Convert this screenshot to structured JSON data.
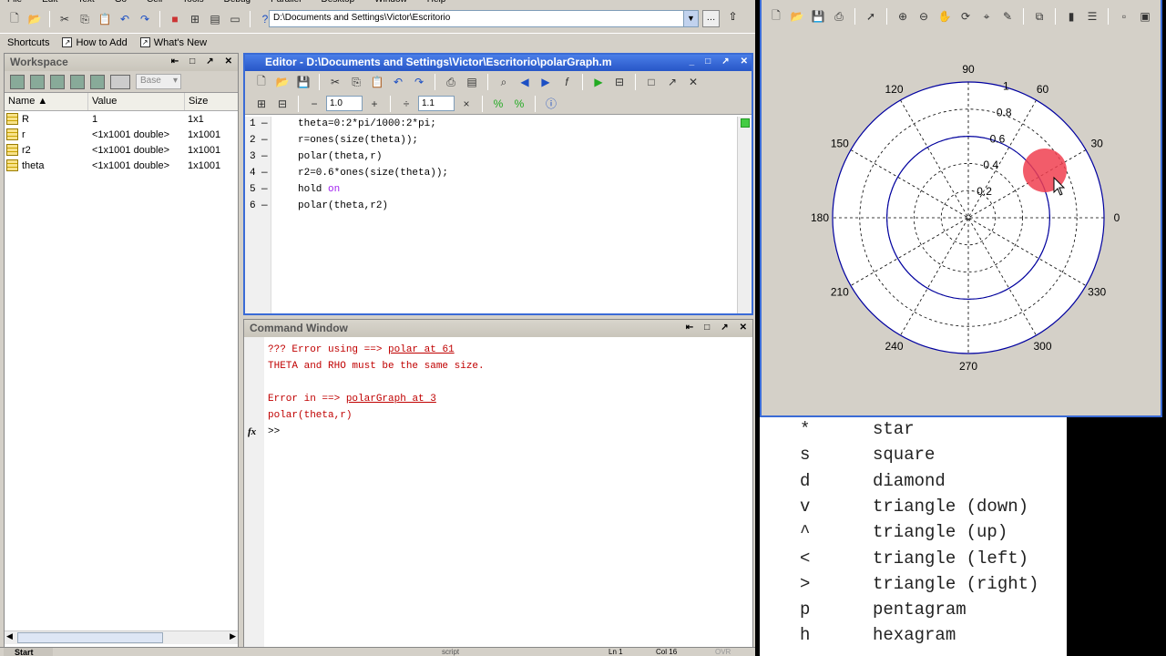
{
  "menu": [
    "File",
    "Edit",
    "Text",
    "Go",
    "Cell",
    "Tools",
    "Debug",
    "Parallel",
    "Desktop",
    "Window",
    "Help"
  ],
  "current_folder": "D:\\Documents and Settings\\Victor\\Escritorio",
  "shortcuts": {
    "label": "Shortcuts",
    "how_to_add": "How to Add",
    "whats_new": "What's New"
  },
  "workspace": {
    "title": "Workspace",
    "base_label": "Base",
    "columns": [
      "Name",
      "Value",
      "Size"
    ],
    "rows": [
      {
        "name": "R",
        "value": "1",
        "size": "1x1"
      },
      {
        "name": "r",
        "value": "<1x1001 double>",
        "size": "1x1001"
      },
      {
        "name": "r2",
        "value": "<1x1001 double>",
        "size": "1x1001"
      },
      {
        "name": "theta",
        "value": "<1x1001 double>",
        "size": "1x1001"
      }
    ]
  },
  "editor": {
    "title": "Editor - D:\\Documents and Settings\\Victor\\Escritorio\\polarGraph.m",
    "step1": "1.0",
    "step2": "1.1",
    "lines": [
      {
        "n": "1",
        "code": "theta=0:2*pi/1000:2*pi;"
      },
      {
        "n": "2",
        "code": "r=ones(size(theta));"
      },
      {
        "n": "3",
        "code": "polar(theta,r)"
      },
      {
        "n": "4",
        "code": "r2=0.6*ones(size(theta));"
      },
      {
        "n": "5",
        "code": "hold ",
        "kw": "on"
      },
      {
        "n": "6",
        "code": "polar(theta,r2)"
      }
    ]
  },
  "command_window": {
    "title": "Command Window",
    "err1_pre": "??? Error using ==> ",
    "err1_link": "polar at 61",
    "err2": "THETA and RHO must be the same size.",
    "err3_pre": "Error in ==> ",
    "err3_link": "polarGraph at 3",
    "err4": "polar(theta,r)",
    "prompt": ">>",
    "fx": "fx"
  },
  "figure": {
    "angle_labels": [
      "0",
      "30",
      "60",
      "90",
      "120",
      "150",
      "180",
      "210",
      "240",
      "270",
      "300",
      "330"
    ],
    "radius_labels": [
      "0.2",
      "0.4",
      "0.6",
      "0.8",
      "1"
    ],
    "colors": {
      "curve": "#0000a0",
      "highlight": "#f04050"
    }
  },
  "markers": [
    {
      "sym": "*",
      "desc": "star"
    },
    {
      "sym": "s",
      "desc": "square"
    },
    {
      "sym": "d",
      "desc": "diamond"
    },
    {
      "sym": "v",
      "desc": "triangle (down)"
    },
    {
      "sym": "^",
      "desc": "triangle (up)"
    },
    {
      "sym": "<",
      "desc": "triangle (left)"
    },
    {
      "sym": ">",
      "desc": "triangle (right)"
    },
    {
      "sym": "p",
      "desc": "pentagram"
    },
    {
      "sym": "h",
      "desc": "hexagram"
    }
  ],
  "status": {
    "start": "Start",
    "mode": "script",
    "ln_label": "Ln",
    "ln": "1",
    "col_label": "Col",
    "col": "16",
    "ovr": "OVR"
  }
}
